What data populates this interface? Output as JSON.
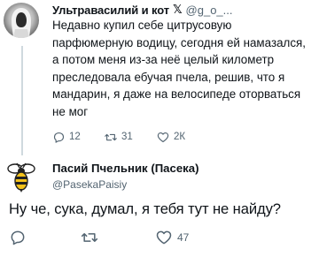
{
  "tweet1": {
    "author_name": "Ультравасилий и кот",
    "x_badge": "𝕏",
    "handle": "@g_o_...",
    "text": "Недавно купил себе цитрусовую парфюмерную водицу, сегодня ей намазался, а потом меня из-за неё целый километр преследовала ебучая пчела, решив, что я мандарин, я даже на велосипеде оторваться не мог",
    "replies": "12",
    "retweets": "31",
    "likes": "2К"
  },
  "tweet2": {
    "author_name": "Пасий Пчельник (Пасека)",
    "handle": "@PasekaPaisiy",
    "text": "Ну че, сука, думал, я тебя тут не найду?",
    "likes": "47"
  },
  "colors": {
    "text": "#0f1419",
    "muted": "#536471",
    "thread_line": "#cfd9de"
  }
}
